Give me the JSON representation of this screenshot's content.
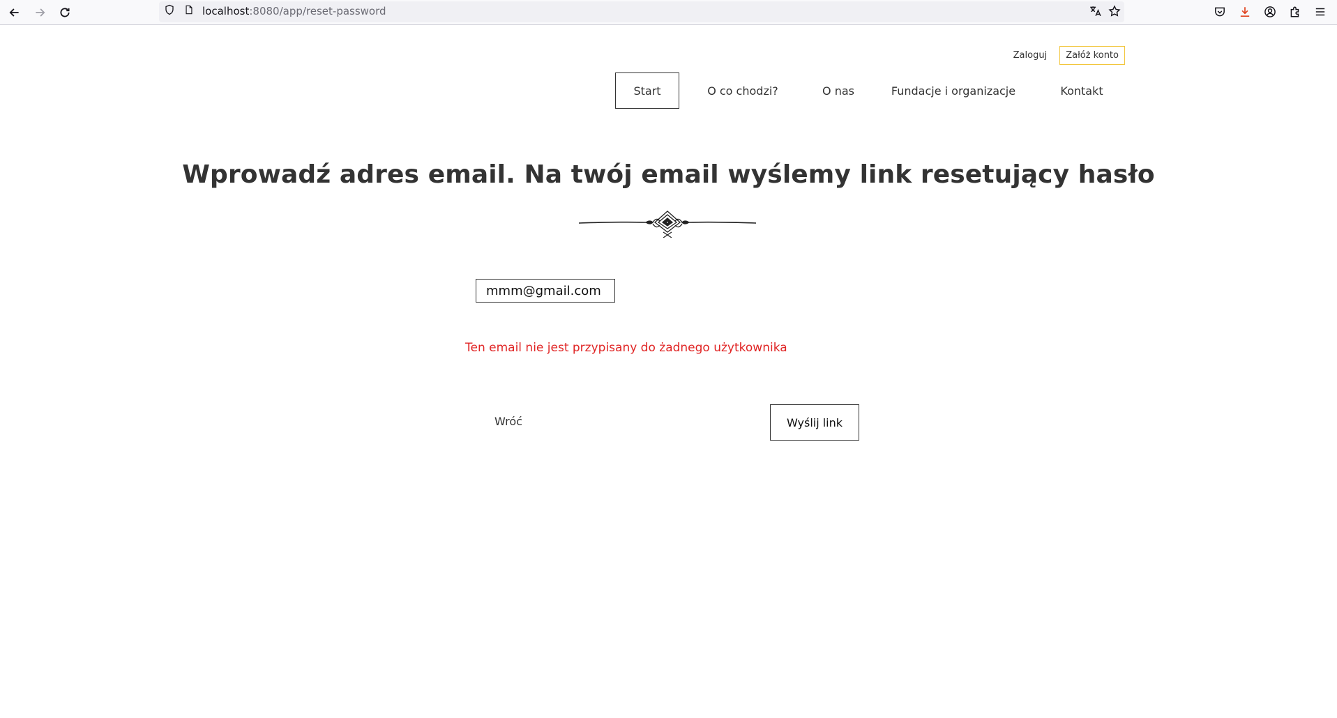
{
  "browser": {
    "url_host": "localhost",
    "url_rest": ":8080/app/reset-password"
  },
  "header": {
    "login_label": "Zaloguj",
    "register_label": "Załóż konto",
    "nav": [
      {
        "label": "Start",
        "active": true
      },
      {
        "label": "O co chodzi?"
      },
      {
        "label": "O nas"
      },
      {
        "label": "Fundacje i organizacje"
      },
      {
        "label": "Kontakt"
      }
    ]
  },
  "main": {
    "title": "Wprowadź adres email. Na twój email wyślemy link resetujący hasło",
    "email_value": "mmm@gmail.com",
    "error": "Ten email nie jest przypisany do żadnego użytkownika",
    "back_label": "Wróć",
    "submit_label": "Wyślij link"
  },
  "colors": {
    "error": "#e02424",
    "register_border": "#f2c63c",
    "text": "#333333"
  }
}
